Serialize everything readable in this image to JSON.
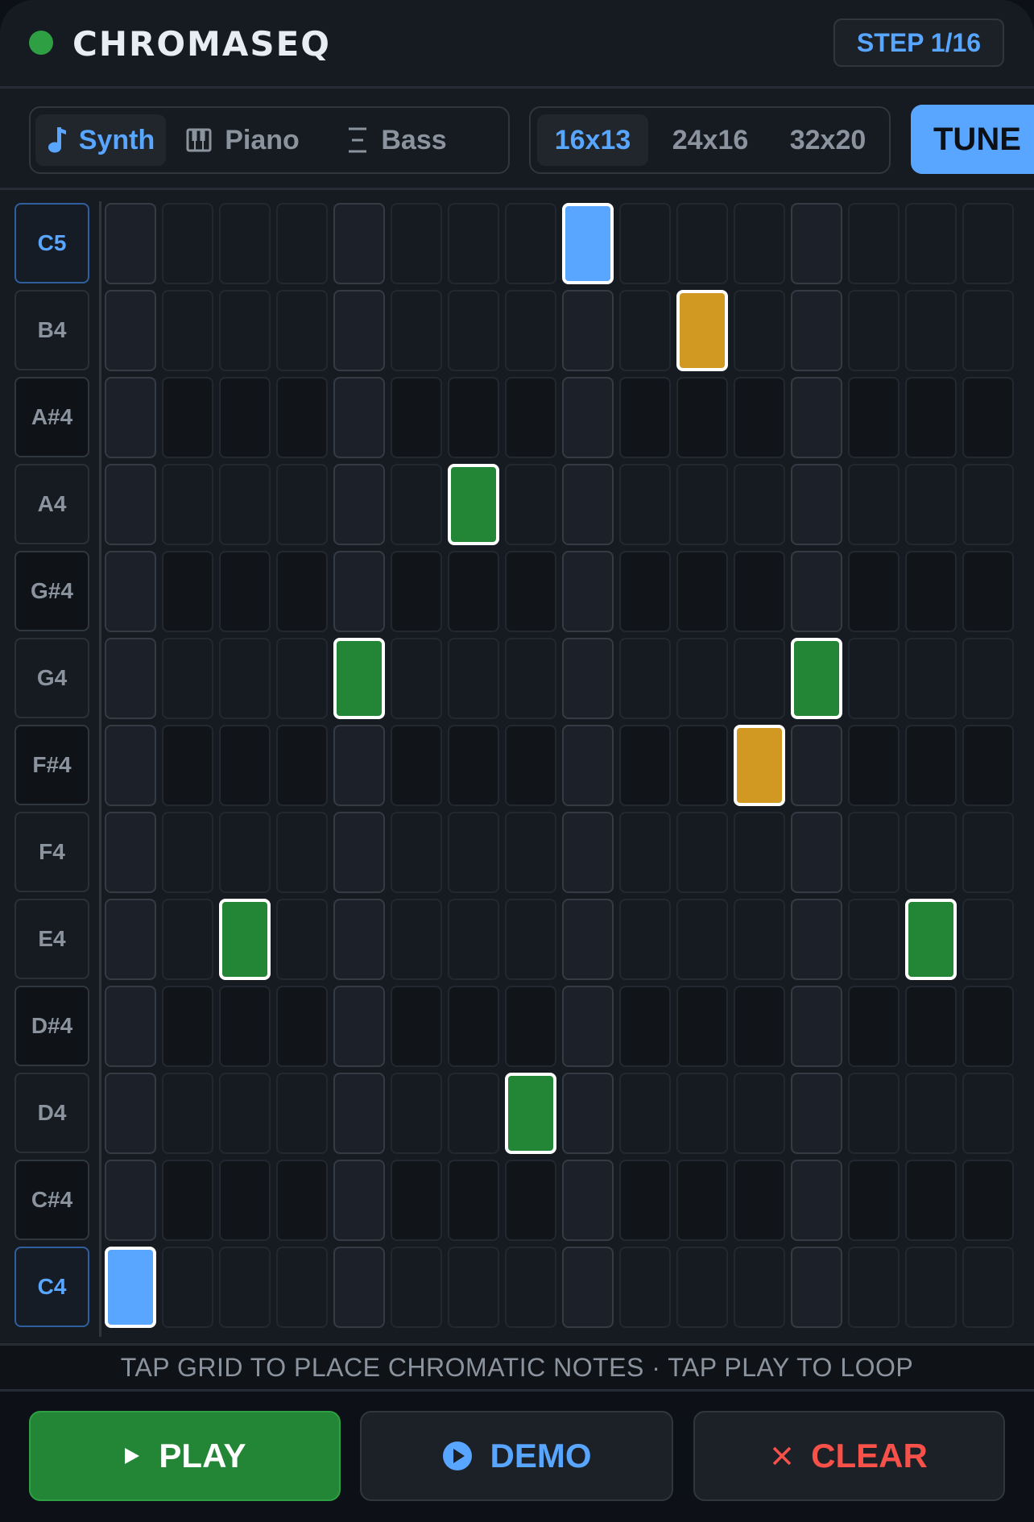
{
  "header": {
    "title": "CHROMASEQ",
    "step": "STEP 1/16",
    "status_color": "#2ea043"
  },
  "instruments": [
    {
      "label": "Synth",
      "icon": "music-note-icon",
      "active": true
    },
    {
      "label": "Piano",
      "icon": "piano-icon",
      "active": false
    },
    {
      "label": "Bass",
      "icon": "bars-icon",
      "active": false
    }
  ],
  "grid_sizes": [
    {
      "label": "16x13",
      "active": true
    },
    {
      "label": "24x16",
      "active": false
    },
    {
      "label": "32x20",
      "active": false
    }
  ],
  "tune_label": "TUNE",
  "notes": [
    "C5",
    "B4",
    "A#4",
    "A4",
    "G#4",
    "G4",
    "F#4",
    "F4",
    "E4",
    "D#4",
    "D4",
    "C#4",
    "C4"
  ],
  "steps": 16,
  "active_cells": [
    {
      "note": "C5",
      "step": 9,
      "color": "blue"
    },
    {
      "note": "B4",
      "step": 11,
      "color": "gold"
    },
    {
      "note": "A4",
      "step": 7,
      "color": "green"
    },
    {
      "note": "G4",
      "step": 5,
      "color": "green"
    },
    {
      "note": "G4",
      "step": 13,
      "color": "green"
    },
    {
      "note": "F#4",
      "step": 12,
      "color": "gold"
    },
    {
      "note": "E4",
      "step": 3,
      "color": "green"
    },
    {
      "note": "E4",
      "step": 15,
      "color": "green"
    },
    {
      "note": "D4",
      "step": 8,
      "color": "green"
    },
    {
      "note": "C4",
      "step": 1,
      "color": "blue"
    }
  ],
  "colors": {
    "accent": "#58a6ff",
    "green": "#238636",
    "gold": "#d29922",
    "danger": "#f85149"
  },
  "hint": "TAP GRID TO PLACE CHROMATIC NOTES · TAP PLAY TO LOOP",
  "footer": {
    "play_label": "PLAY",
    "demo_label": "DEMO",
    "clear_label": "CLEAR"
  }
}
